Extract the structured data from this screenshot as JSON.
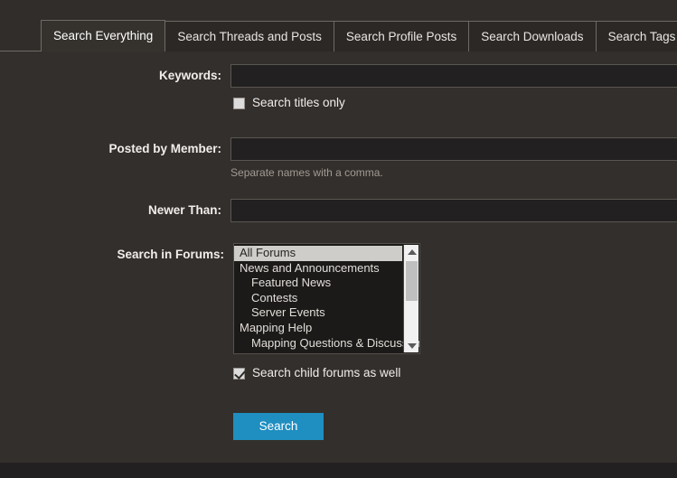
{
  "colors": {
    "page_background": "#302d2a",
    "panel_background": "#332f2c",
    "tab_inactive_background": "#2b2825",
    "tab_active_background": "#35322e",
    "tab_border": "#6f6a64",
    "input_background": "#222020",
    "input_border": "#5a5651",
    "label_text": "#f0eeea",
    "hint_text": "#a29b93",
    "listbox_background": "#1c1a19",
    "listbox_selected_background": "#cfcdc9",
    "listbox_selected_text": "#262422",
    "scrollbar_track": "#f1f1f1",
    "scrollbar_thumb": "#bfbfbf",
    "button_background": "#1f8ec1",
    "button_text": "#ffffff",
    "footer_background": "#222020"
  },
  "tabs": [
    {
      "label": "Search Everything",
      "active": true
    },
    {
      "label": "Search Threads and Posts",
      "active": false
    },
    {
      "label": "Search Profile Posts",
      "active": false
    },
    {
      "label": "Search Downloads",
      "active": false
    },
    {
      "label": "Search Tags",
      "active": false
    }
  ],
  "form": {
    "keywords": {
      "label": "Keywords:",
      "value": "",
      "placeholder": ""
    },
    "search_titles_only": {
      "label": "Search titles only",
      "checked": false
    },
    "posted_by_member": {
      "label": "Posted by Member:",
      "value": "",
      "placeholder": "",
      "hint": "Separate names with a comma."
    },
    "newer_than": {
      "label": "Newer Than:",
      "value": "",
      "placeholder": ""
    },
    "search_in_forums": {
      "label": "Search in Forums:",
      "options": [
        {
          "text": "All Forums",
          "indent": false,
          "selected": true
        },
        {
          "text": "News and Announcements",
          "indent": false,
          "selected": false
        },
        {
          "text": "Featured News",
          "indent": true,
          "selected": false
        },
        {
          "text": "Contests",
          "indent": true,
          "selected": false
        },
        {
          "text": "Server Events",
          "indent": true,
          "selected": false
        },
        {
          "text": "Mapping Help",
          "indent": false,
          "selected": false
        },
        {
          "text": "Mapping Questions & Discussion",
          "indent": true,
          "selected": false
        }
      ],
      "scroll_up_icon": "triangle-up-icon",
      "scroll_down_icon": "triangle-down-icon"
    },
    "search_child_forums": {
      "label": "Search child forums as well",
      "checked": true
    },
    "submit": {
      "label": "Search"
    }
  }
}
